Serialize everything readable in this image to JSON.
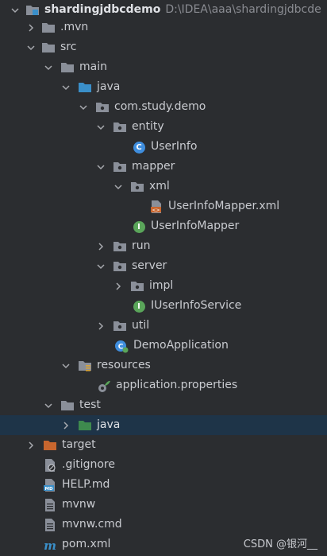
{
  "root": {
    "label": "shardingjdbcdemo",
    "path": "D:\\IDEA\\aaa\\shardingjdbcde"
  },
  "items": {
    "mvn": ".mvn",
    "src": "src",
    "main": "main",
    "java_main": "java",
    "package": "com.study.demo",
    "entity": "entity",
    "userinfo": "UserInfo",
    "mapper": "mapper",
    "xml": "xml",
    "mapper_xml": "UserInfoMapper.xml",
    "mapper_iface": "UserInfoMapper",
    "run": "run",
    "server": "server",
    "impl": "impl",
    "service_iface": "IUserInfoService",
    "util": "util",
    "demo_app": "DemoApplication",
    "resources": "resources",
    "app_props": "application.properties",
    "test": "test",
    "java_test": "java",
    "target": "target",
    "gitignore": ".gitignore",
    "help": "HELP.md",
    "mvnw": "mvnw",
    "mvnw_cmd": "mvnw.cmd",
    "pom": "pom.xml"
  },
  "icons": {
    "folder": "folder-icon",
    "package": "package-icon",
    "class": "class-icon",
    "interface": "interface-icon",
    "xml_file": "xml-file-icon",
    "spring_boot": "spring-boot-app-icon",
    "properties": "properties-file-icon",
    "text_file": "text-file-icon",
    "markdown": "markdown-file-icon",
    "maven": "maven-icon"
  },
  "watermark": "CSDN @银河__",
  "colors": {
    "background": "#2b2d30",
    "selection": "#1e3448",
    "folder": "#8a8f99",
    "source_folder": "#3a8fc9",
    "test_folder": "#3e8a4e",
    "target_folder": "#c8662e",
    "class_blue": "#3f8ede",
    "interface_green": "#5aa55a"
  }
}
